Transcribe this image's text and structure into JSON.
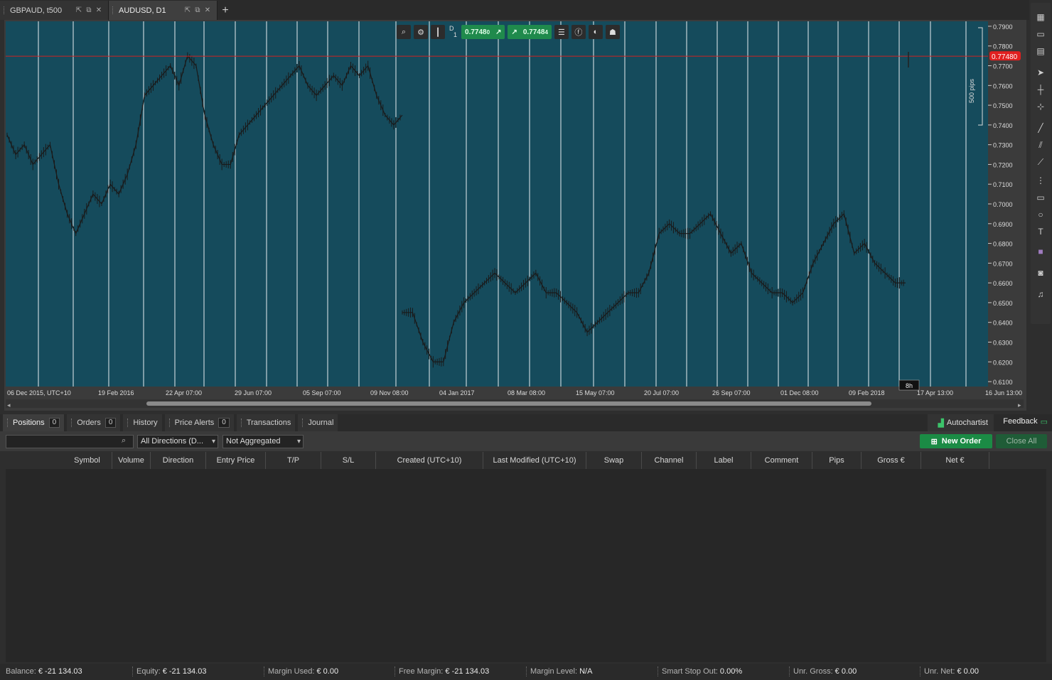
{
  "tabs": [
    {
      "title": "GBPAUD, t500",
      "active": false
    },
    {
      "title": "AUDUSD, D1",
      "active": true
    }
  ],
  "chart": {
    "timeframe": "D",
    "timeframe_sub": "1",
    "sell_price": "0.7748",
    "sell_price_small": "0",
    "buy_price": "0.7748",
    "buy_price_small": "4",
    "current_price_label": "0.77480",
    "pips_label": "500 pips",
    "timer_label": "8h",
    "background": "#154b5c",
    "price_line_color": "#cc2222",
    "y_ticks": [
      "0.7900",
      "0.7800",
      "0.7700",
      "0.7600",
      "0.7500",
      "0.7400",
      "0.7300",
      "0.7200",
      "0.7100",
      "0.7000",
      "0.6900",
      "0.6800",
      "0.6700",
      "0.6600",
      "0.6500",
      "0.6400",
      "0.6300",
      "0.6200",
      "0.6100"
    ],
    "x_ticks": [
      "06 Dec 2015, UTC+10",
      "19 Feb 2016",
      "22 Apr 07:00",
      "29 Jun 07:00",
      "05 Sep 07:00",
      "09 Nov 08:00",
      "04 Jan 2017",
      "08 Mar 08:00",
      "15 May 07:00",
      "20 Jul 07:00",
      "26 Sep 07:00",
      "01 Dec 08:00",
      "09 Feb 2018",
      "17 Apr 13:00",
      "16 Jun 13:00"
    ]
  },
  "chart_data": {
    "type": "line",
    "title": "AUDUSD, D1",
    "ylim": [
      0.6075,
      0.7925
    ],
    "current_price": 0.7748,
    "series": [
      {
        "values": [
          0.735,
          0.725,
          0.73,
          0.72,
          0.725,
          0.73,
          0.71,
          0.695,
          0.685,
          0.695,
          0.705,
          0.7,
          0.71,
          0.705,
          0.715,
          0.73,
          0.755,
          0.76,
          0.765,
          0.77,
          0.76,
          0.775,
          0.77,
          0.745,
          0.73,
          0.72,
          0.72,
          0.735,
          0.74,
          0.745,
          0.75,
          0.755,
          0.76,
          0.765,
          0.77,
          0.76,
          0.755,
          0.76,
          0.765,
          0.76,
          0.77,
          0.765,
          0.77,
          0.755,
          0.745,
          0.74,
          0.745
        ]
      },
      {
        "values": [
          0.645,
          0.645,
          0.63,
          0.62,
          0.62,
          0.64,
          0.65,
          0.655,
          0.66,
          0.665,
          0.66,
          0.655,
          0.66,
          0.665,
          0.655,
          0.655,
          0.65,
          0.645,
          0.635,
          0.64,
          0.645,
          0.65,
          0.655,
          0.655,
          0.665,
          0.685,
          0.69,
          0.685,
          0.685,
          0.69,
          0.695,
          0.685,
          0.675,
          0.68,
          0.665,
          0.66,
          0.655,
          0.655,
          0.65,
          0.655,
          0.67,
          0.68,
          0.69,
          0.695,
          0.675,
          0.68,
          0.67,
          0.665,
          0.66,
          0.66
        ]
      }
    ]
  },
  "bottom_tabs": [
    {
      "label": "Positions",
      "count": "0",
      "active": true
    },
    {
      "label": "Orders",
      "count": "0",
      "active": false
    },
    {
      "label": "History",
      "count": null,
      "active": false
    },
    {
      "label": "Price Alerts",
      "count": "0",
      "active": false
    },
    {
      "label": "Transactions",
      "count": null,
      "active": false
    },
    {
      "label": "Journal",
      "count": null,
      "active": false
    }
  ],
  "autochartist_label": "Autochartist",
  "feedback_label": "Feedback",
  "filters": {
    "search_placeholder": "",
    "direction": "All Directions (D...",
    "aggregation": "Not Aggregated",
    "new_order": "New Order",
    "close_all": "Close All"
  },
  "table": {
    "columns": [
      "Symbol",
      "Volume",
      "Direction",
      "Entry Price",
      "T/P",
      "S/L",
      "Created (UTC+10)",
      "Last Modified (UTC+10)",
      "Swap",
      "Channel",
      "Label",
      "Comment",
      "Pips",
      "Gross €",
      "Net €"
    ],
    "rows": []
  },
  "status": [
    {
      "label": "Balance:",
      "value": "€ -21 134.03"
    },
    {
      "label": "Equity:",
      "value": "€ -21 134.03"
    },
    {
      "label": "Margin Used:",
      "value": "€ 0.00"
    },
    {
      "label": "Free Margin:",
      "value": "€ -21 134.03"
    },
    {
      "label": "Margin Level:",
      "value": "N/A"
    },
    {
      "label": "Smart Stop Out:",
      "value": "0.00%"
    },
    {
      "label": "Unr. Gross:",
      "value": "€ 0.00"
    },
    {
      "label": "Unr. Net:",
      "value": "€ 0.00"
    }
  ]
}
